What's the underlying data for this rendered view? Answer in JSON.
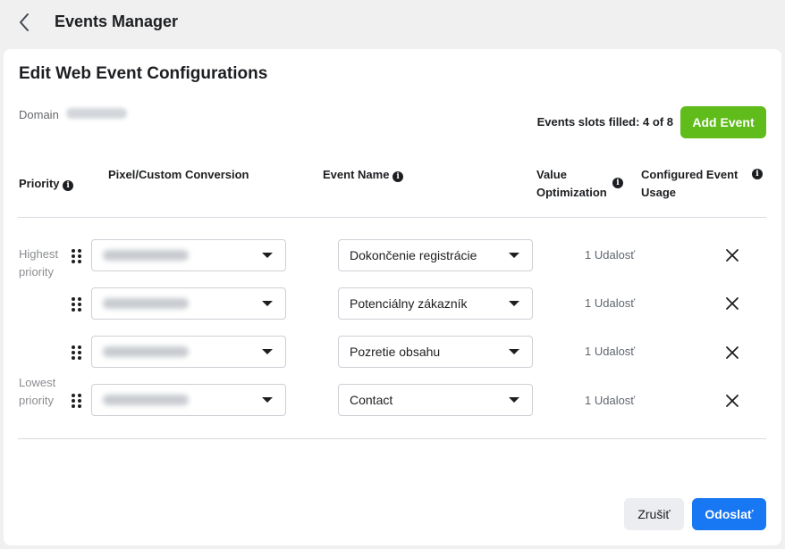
{
  "header": {
    "title": "Events Manager",
    "back_icon": "chevron-left-icon"
  },
  "dialog": {
    "title": "Edit Web Event Configurations",
    "domain_label": "Domain",
    "slots_text": "Events slots filled: 4 of 8",
    "add_event_label": "Add Event",
    "columns": {
      "priority": "Priority",
      "pixel": "Pixel/Custom Conversion",
      "event_name": "Event Name",
      "value_opt_line1": "Value",
      "value_opt_line2": "Optimization",
      "usage_line1": "Configured Event",
      "usage_line2": "Usage"
    },
    "priority_labels": {
      "highest_line1": "Highest",
      "highest_line2": "priority",
      "lowest_line1": "Lowest",
      "lowest_line2": "priority"
    },
    "rows": [
      {
        "event": "Dokončenie registrácie",
        "usage": "1 Udalosť"
      },
      {
        "event": "Potenciálny zákazník",
        "usage": "1 Udalosť"
      },
      {
        "event": "Pozretie obsahu",
        "usage": "1 Udalosť"
      },
      {
        "event": "Contact",
        "usage": "1 Udalosť"
      }
    ],
    "cancel_label": "Zrušiť",
    "submit_label": "Odoslať"
  },
  "colors": {
    "accent_green": "#5fbc1b",
    "primary_blue": "#1877f2"
  }
}
